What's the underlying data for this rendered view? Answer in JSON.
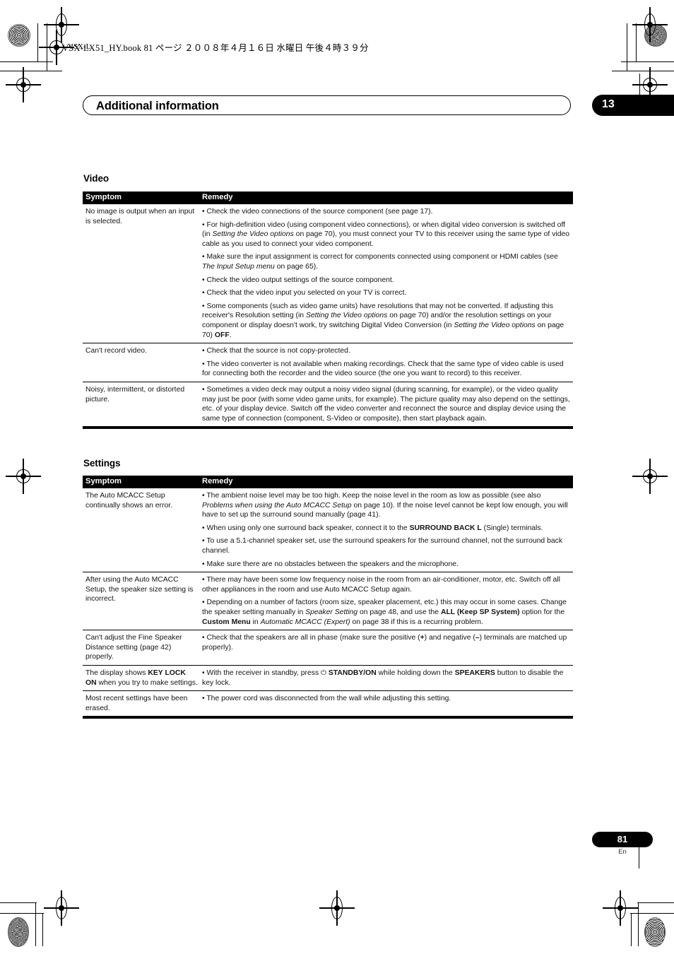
{
  "print_header": {
    "book_line": "VSX-LX51_HY.book   81 ページ   ２００８年４月１６日   水曜日   午後４時３９分",
    "corner_label": "VSX-L"
  },
  "chapter": {
    "title": "Additional information",
    "number": "13"
  },
  "footer": {
    "page_number": "81",
    "language": "En"
  },
  "sections": [
    {
      "heading": "Video",
      "columns": {
        "symptom": "Symptom",
        "remedy": "Remedy"
      },
      "rows": [
        {
          "symptom": "No image is output when an input is selected.",
          "remedy": [
            "• Check the video connections of the source component (see page 17).",
            "• For high-definition video (using component video connections), or when digital video conversion is switched off (in <i>Setting the Video options</i> on page 70), you must connect your TV to this receiver using the same type of video cable as you used to connect your video component.",
            "• Make sure the input assignment is correct for components connected using component or HDMI cables (see <i>The Input Setup menu</i> on page 65).",
            "• Check the video output settings of the source component.",
            "• Check that the video input you selected on your TV is correct.",
            "• Some components (such as video game units) have resolutions that may not be converted. If adjusting this receiver's Resolution setting (in <i>Setting the Video options</i> on page 70) and/or the resolution settings on your component or display doesn't work, try switching Digital Video Conversion (in <i>Setting the Video options</i> on page 70) <b>OFF</b>."
          ]
        },
        {
          "symptom": "Can't record video.",
          "remedy": [
            "• Check that the source is not copy-protected.",
            "• The video converter is not available when making recordings. Check that the same type of video cable is used for connecting both the recorder and the video source (the one you want to record) to this receiver."
          ]
        },
        {
          "symptom": "Noisy, intermittent, or distorted picture.",
          "remedy": [
            "• Sometimes a video deck may output a noisy video signal (during scanning, for example), or the video quality may just be poor (with some video game units, for example). The picture quality may also depend on the settings, etc. of your display device. Switch off the video converter and reconnect the source and display device using the same type of connection (component, S-Video or composite), then start playback again."
          ]
        }
      ]
    },
    {
      "heading": "Settings",
      "columns": {
        "symptom": "Symptom",
        "remedy": "Remedy"
      },
      "rows": [
        {
          "symptom": "The Auto MCACC Setup continually shows an error.",
          "remedy": [
            "• The ambient noise level may be too high. Keep the noise level in the room as low as possible (see also <i>Problems when using the Auto MCACC Setup</i> on page 10). If the noise level cannot be kept low enough, you will have to set up the surround sound manually (page 41).",
            "• When using only one surround back speaker, connect it to the <b>SURROUND BACK L</b> (Single) terminals.",
            "• To use a 5.1-channel speaker set, use the surround speakers for the surround channel, not the surround back channel.",
            "• Make sure there are no obstacles between the speakers and the microphone."
          ]
        },
        {
          "symptom": "After using the Auto MCACC Setup, the speaker size setting is incorrect.",
          "remedy": [
            "• There may have been some low frequency noise in the room from an air-conditioner, motor, etc. Switch off all other appliances in the room and use Auto MCACC Setup again.",
            "• Depending on a number of factors (room size, speaker placement, etc.) this may occur in some cases. Change the speaker setting manually in <i>Speaker Setting</i> on page 48, and use the <b>ALL (Keep SP System)</b> option for the <b>Custom Menu</b> in <i>Automatic MCACC (Expert)</i> on page 38 if this is a recurring problem."
          ]
        },
        {
          "symptom": "Can't adjust the Fine Speaker Distance setting (page 42) properly.",
          "remedy": [
            "• Check that the speakers are all in phase (make sure the positive (<b>+</b>) and negative (<b>–</b>) terminals are matched up properly)."
          ]
        },
        {
          "symptom": "The display shows <b>KEY LOCK ON</b> when you try to make settings.",
          "remedy": [
            "• With the receiver in standby, press <span class=\"pwr\">⏻</span> <b>STANDBY/ON</b> while holding down the <b>SPEAKERS</b> button to disable the key lock."
          ]
        },
        {
          "symptom": "Most recent settings have been erased.",
          "remedy": [
            "• The power cord was disconnected from the wall while adjusting this setting."
          ]
        }
      ]
    }
  ]
}
